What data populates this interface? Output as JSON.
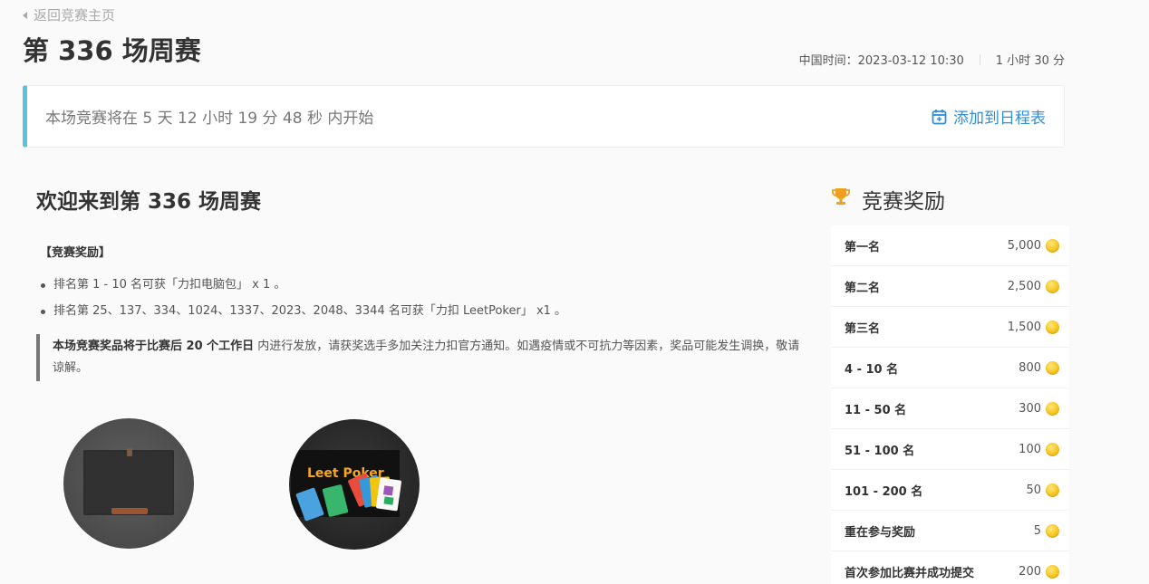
{
  "back_link": "返回竞赛主页",
  "title": "第 336 场周赛",
  "meta": {
    "time": "中国时间：2023-03-12 10:30",
    "duration": "1 小时 30 分"
  },
  "countdown": {
    "text": "本场竞赛将在 5 天 12 小时 19 分 48 秒 内开始",
    "calendar_label": "添加到日程表"
  },
  "welcome": "欢迎来到第 336 场周赛",
  "rewards_label": "【竞赛奖励】",
  "reward_items": [
    "排名第 1 - 10 名可获「力扣电脑包」 x 1 。",
    "排名第 25、137、334、1024、1337、2023、2048、3344 名可获「力扣 LeetPoker」 x1 。"
  ],
  "notice": {
    "bold": "本场竞赛奖品将于比赛后 20 个工作日",
    "rest": " 内进行发放，请获奖选手多加关注力扣官方通知。如遇疫情或不可抗力等因素，奖品可能发生调换，敬请谅解。"
  },
  "prizes": {
    "poker_label": "Leet Poker"
  },
  "rewards_panel": {
    "heading": "竞赛奖励",
    "rows": [
      {
        "rank": "第一名",
        "points": "5,000"
      },
      {
        "rank": "第二名",
        "points": "2,500"
      },
      {
        "rank": "第三名",
        "points": "1,500"
      },
      {
        "rank": "4 - 10 名",
        "points": "800"
      },
      {
        "rank": "11 - 50 名",
        "points": "300"
      },
      {
        "rank": "51 - 100 名",
        "points": "100"
      },
      {
        "rank": "101 - 200 名",
        "points": "50"
      },
      {
        "rank": "重在参与奖励",
        "points": "5"
      },
      {
        "rank": "首次参加比赛并成功提交",
        "points": "200"
      }
    ]
  },
  "colors": {
    "accent": "#5bc0de",
    "link": "#2b8fd9",
    "trophy": "#f0a020",
    "coin": "#f8c320"
  },
  "icons": {
    "back": "caret-left-icon",
    "calendar": "calendar-plus-icon",
    "trophy": "trophy-icon",
    "coin": "coin-icon"
  }
}
